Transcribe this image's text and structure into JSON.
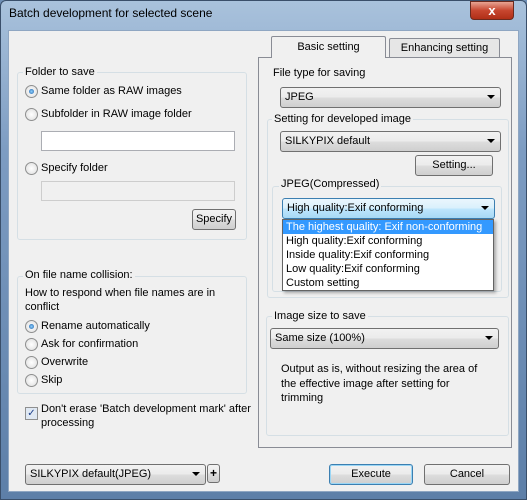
{
  "window": {
    "title": "Batch development for selected scene",
    "close": "x"
  },
  "folder": {
    "label": "Folder to save",
    "options": [
      "Same folder as RAW images",
      "Subfolder in RAW image folder",
      "Specify folder"
    ],
    "selected": 0,
    "subfolder_value": "",
    "specify_value": "",
    "specify_button": "Specify"
  },
  "collision": {
    "label": "On file name collision:",
    "prompt_line1": "How to respond when file names are in",
    "prompt_line2": "conflict",
    "options": [
      "Rename automatically",
      "Ask for confirmation",
      "Overwrite",
      "Skip"
    ],
    "selected": 0
  },
  "keep_mark": {
    "checked": true,
    "line1": "Don't erase 'Batch development mark' after",
    "line2": "processing"
  },
  "preset": {
    "value": "SILKYPIX default(JPEG)",
    "add_icon": "plus-icon"
  },
  "buttons": {
    "execute": "Execute",
    "cancel": "Cancel"
  },
  "tabs": [
    {
      "label": "Basic setting",
      "active": true
    },
    {
      "label": "Enhancing setting",
      "active": false
    }
  ],
  "basic": {
    "file_type_label": "File type for saving",
    "file_type_value": "JPEG",
    "dev_label": "Setting for developed image",
    "dev_value": "SILKYPIX default",
    "setting_button": "Setting...",
    "jpeg_label": "JPEG(Compressed)",
    "jpeg_value": "High quality:Exif conforming",
    "jpeg_options": [
      "The highest quality: Exif non-conforming",
      "High quality:Exif conforming",
      "Inside quality:Exif conforming",
      "Low quality:Exif conforming",
      "Custom setting"
    ],
    "jpeg_highlighted": 0,
    "size_label": "Image size to save",
    "size_value": "Same size (100%)",
    "size_desc": [
      "Output as is, without resizing the area of",
      "the effective image after setting for",
      "trimming"
    ]
  },
  "colors": {
    "highlight": "#3399ff",
    "focus_border": "#3c7fb1"
  }
}
